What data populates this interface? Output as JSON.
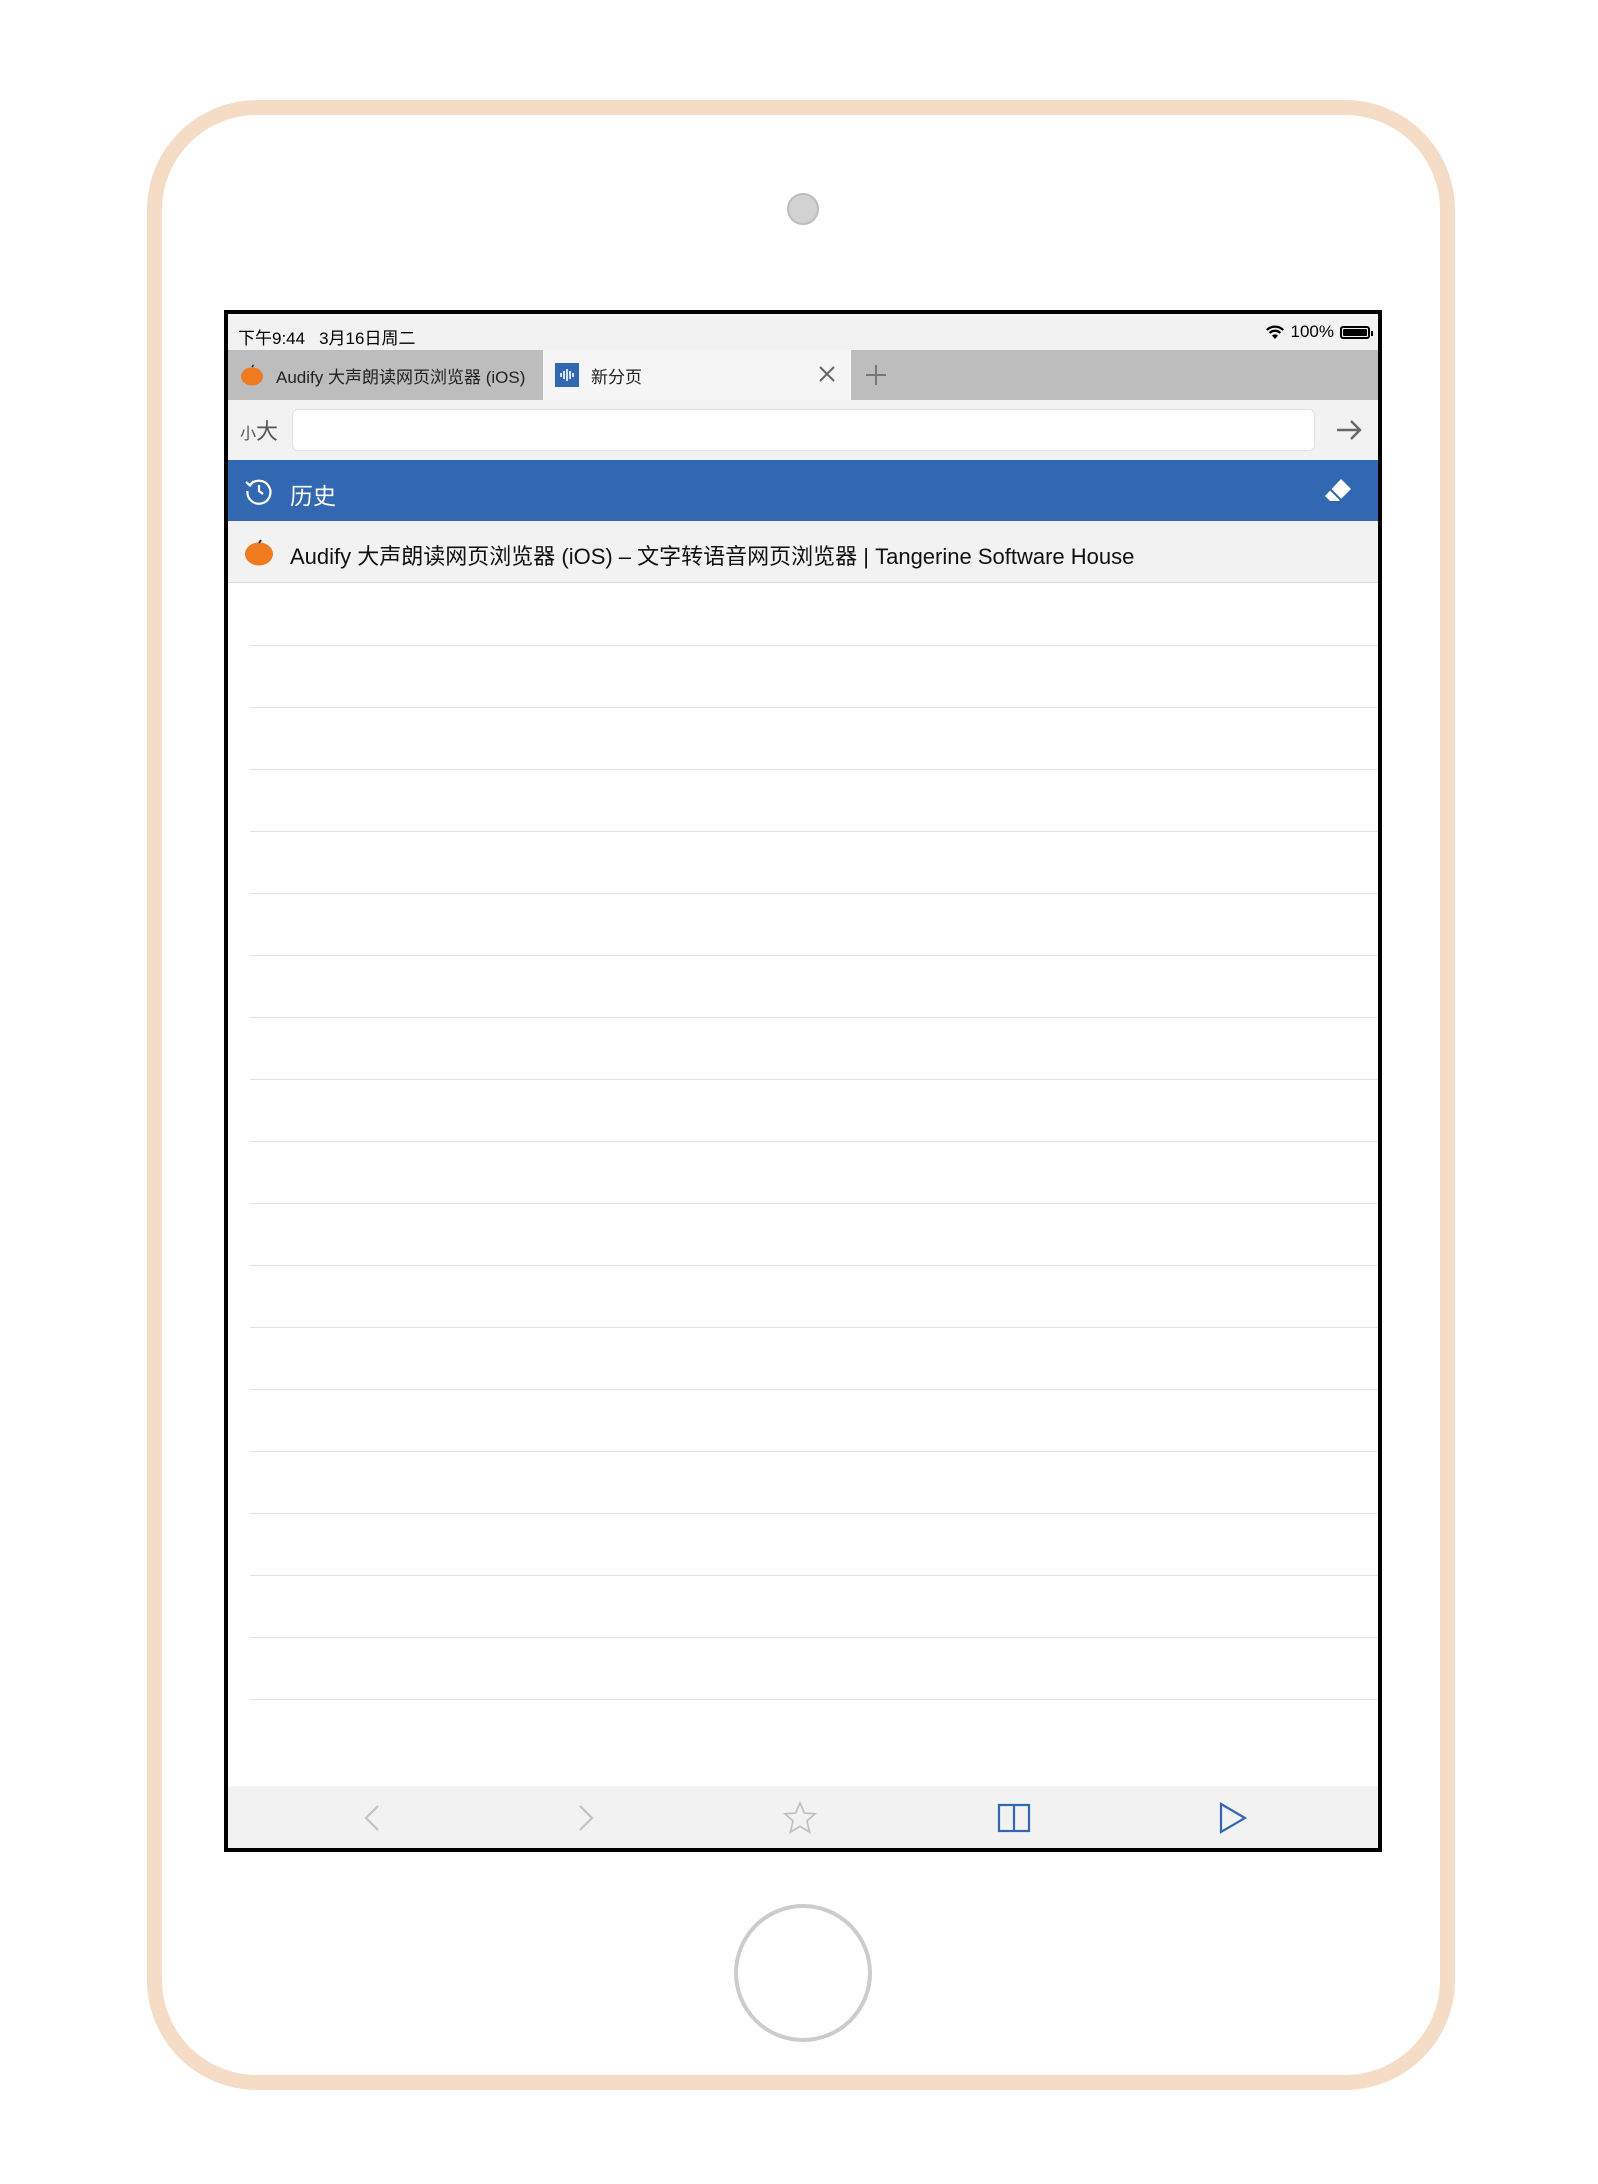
{
  "status": {
    "time": "下午9:44",
    "date": "3月16日周二",
    "battery": "100%"
  },
  "tabs": [
    {
      "title": "Audify 大声朗读网页浏览器 (iOS)",
      "active": false
    },
    {
      "title": "新分页",
      "active": true
    }
  ],
  "address": {
    "font_small": "小",
    "font_large": "大",
    "value": "",
    "placeholder": ""
  },
  "history": {
    "title": "历史",
    "items": [
      {
        "title": "Audify 大声朗读网页浏览器 (iOS) – 文字转语音网页浏览器 | Tangerine Software House"
      }
    ]
  },
  "colors": {
    "accent": "#3267b1",
    "favicon": "#f07a1f",
    "frame": "#f5dcc6"
  },
  "icons": [
    "wifi-icon",
    "battery-icon",
    "tangerine-favicon",
    "audify-icon",
    "close-icon",
    "plus-icon",
    "arrow-right-icon",
    "clock-icon",
    "eraser-icon",
    "back-icon",
    "forward-icon",
    "star-icon",
    "split-view-icon",
    "play-icon"
  ]
}
